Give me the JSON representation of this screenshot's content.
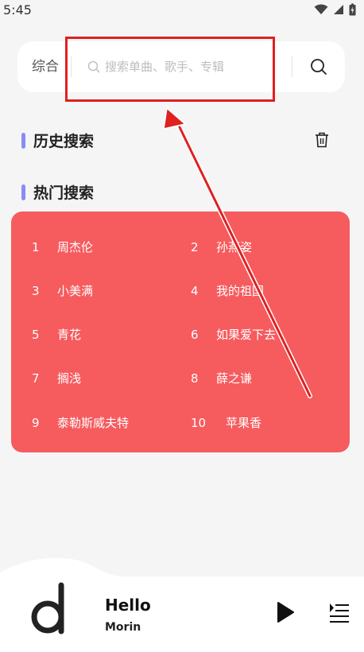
{
  "status_bar": {
    "time": "5:45"
  },
  "search": {
    "category_label": "综合",
    "placeholder": "搜索单曲、歌手、专辑"
  },
  "history": {
    "title": "历史搜索"
  },
  "hot": {
    "title": "热门搜索",
    "items": [
      {
        "rank": "1",
        "label": "周杰伦"
      },
      {
        "rank": "2",
        "label": "孙燕姿"
      },
      {
        "rank": "3",
        "label": "小美满"
      },
      {
        "rank": "4",
        "label": "我的祖国"
      },
      {
        "rank": "5",
        "label": "青花"
      },
      {
        "rank": "6",
        "label": "如果爱下去"
      },
      {
        "rank": "7",
        "label": "搁浅"
      },
      {
        "rank": "8",
        "label": "薛之谦"
      },
      {
        "rank": "9",
        "label": "泰勒斯威夫特"
      },
      {
        "rank": "10",
        "label": "苹果香"
      }
    ]
  },
  "player": {
    "title": "Hello",
    "artist": "Morin"
  },
  "colors": {
    "accent_bar": "#8a8cf6",
    "hot_panel": "#f65b5e",
    "annotation_red": "#e02020"
  }
}
